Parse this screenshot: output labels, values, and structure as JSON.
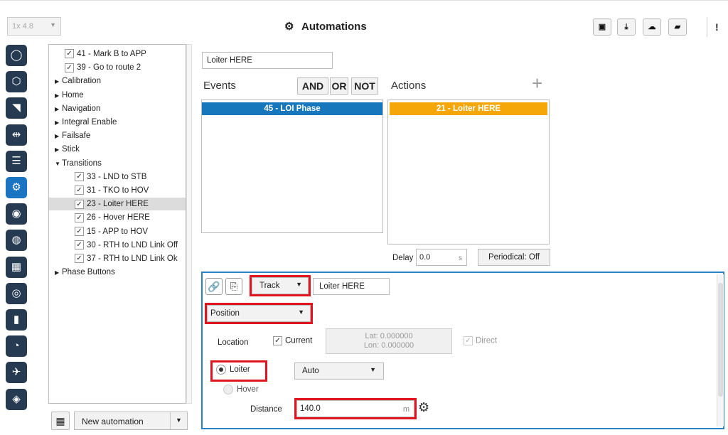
{
  "header": {
    "version": "1x 4.8",
    "title": "Automations",
    "toolbar_icons": [
      "save-icon",
      "download-icon",
      "cloud-upload-icon",
      "folder-open-icon",
      "info-icon"
    ]
  },
  "sidebar": {
    "icons": [
      "power-icon",
      "hexagon-icon",
      "signal-icon",
      "usb-icon",
      "sliders-icon",
      "automations-icon",
      "podcast-icon",
      "gamepad-icon",
      "grid-icon",
      "camera-icon",
      "chart-icon",
      "gauge-icon",
      "plane-icon",
      "shield-icon"
    ],
    "active_index": 5
  },
  "tree": {
    "items": [
      {
        "label": "41 - Mark B to APP",
        "type": "check",
        "level": 1
      },
      {
        "label": "39 - Go to route 2",
        "type": "check",
        "level": 1
      },
      {
        "label": "Calibration",
        "type": "group",
        "expanded": false
      },
      {
        "label": "Home",
        "type": "group",
        "expanded": false
      },
      {
        "label": "Navigation",
        "type": "group",
        "expanded": false
      },
      {
        "label": "Integral Enable",
        "type": "group",
        "expanded": false
      },
      {
        "label": "Failsafe",
        "type": "group",
        "expanded": false
      },
      {
        "label": "Stick",
        "type": "group",
        "expanded": false
      },
      {
        "label": "Transitions",
        "type": "group",
        "expanded": true
      },
      {
        "label": "33 - LND to STB",
        "type": "check",
        "level": 2
      },
      {
        "label": "31 - TKO to HOV",
        "type": "check",
        "level": 2
      },
      {
        "label": "23 - Loiter HERE",
        "type": "check",
        "level": 2,
        "selected": true
      },
      {
        "label": "26 - Hover HERE",
        "type": "check",
        "level": 2
      },
      {
        "label": "15 - APP to HOV",
        "type": "check",
        "level": 2
      },
      {
        "label": "30 - RTH to LND Link Off",
        "type": "check",
        "level": 2
      },
      {
        "label": "37 - RTH to LND Link Ok",
        "type": "check",
        "level": 2
      },
      {
        "label": "Phase Buttons",
        "type": "group",
        "expanded": false
      }
    ],
    "new_automation_label": "New automation"
  },
  "editor": {
    "automation_name": "Loiter HERE",
    "events_label": "Events",
    "and_label": "AND",
    "or_label": "OR",
    "not_label": "NOT",
    "actions_label": "Actions",
    "add_action_symbol": "+",
    "events": [
      "45 - LOI Phase"
    ],
    "actions": [
      "21 - Loiter HERE"
    ],
    "delay_label": "Delay",
    "delay_value": "0.0",
    "delay_unit": "s",
    "periodical_label": "Periodical: Off"
  },
  "action_panel": {
    "type_value": "Track",
    "name_value": "Loiter HERE",
    "mode_value": "Position",
    "location_label": "Location",
    "current_label": "Current",
    "current_checked": true,
    "lat": "Lat: 0.000000",
    "lon": "Lon: 0.000000",
    "direct_label": "Direct",
    "loiter_label": "Loiter",
    "loiter_selected": true,
    "auto_value": "Auto",
    "hover_label": "Hover",
    "distance_label": "Distance",
    "distance_value": "140.0",
    "distance_unit": "m"
  },
  "colors": {
    "sidebar_icon": "#263a52",
    "sidebar_active": "#1b74c2",
    "event_item": "#1777bd",
    "action_item": "#f5a70a",
    "highlight_box": "#e0151f",
    "panel_border": "#2b82c8"
  }
}
